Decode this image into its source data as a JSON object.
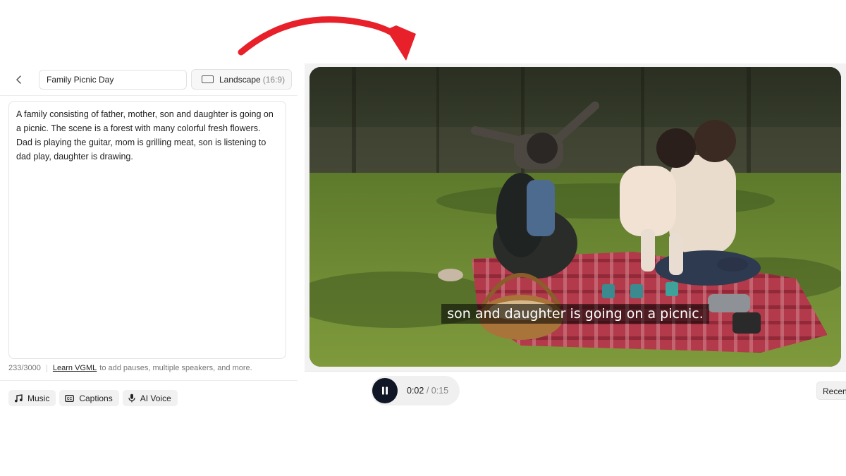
{
  "editor": {
    "back_icon": "chevron-left-icon",
    "title_value": "Family Picnic Day",
    "aspect_label": "Landscape",
    "aspect_ratio": "(16:9)",
    "prompt_text": "A family consisting of father, mother, son and daughter is going on a picnic. The scene is a forest with many colorful fresh flowers. Dad is playing the guitar, mom is grilling meat, son is listening to dad play, daughter is drawing.",
    "char_count": "233/3000",
    "learn_link": "Learn VGML",
    "learn_suffix": "to add pauses, multiple speakers, and more."
  },
  "toolbar": {
    "chips": [
      {
        "label": "Music",
        "icon": "music-note-icon"
      },
      {
        "label": "Captions",
        "icon": "captions-icon"
      },
      {
        "label": "AI Voice",
        "icon": "microphone-icon"
      }
    ]
  },
  "preview": {
    "caption": "son and daughter is going on a picnic.",
    "time_current": "0:02",
    "time_total": "/ 0:15",
    "progress": 0.133,
    "recent_label": "Recent"
  },
  "colors": {
    "arrow": "#e8202a",
    "pause_button": "#101625"
  }
}
